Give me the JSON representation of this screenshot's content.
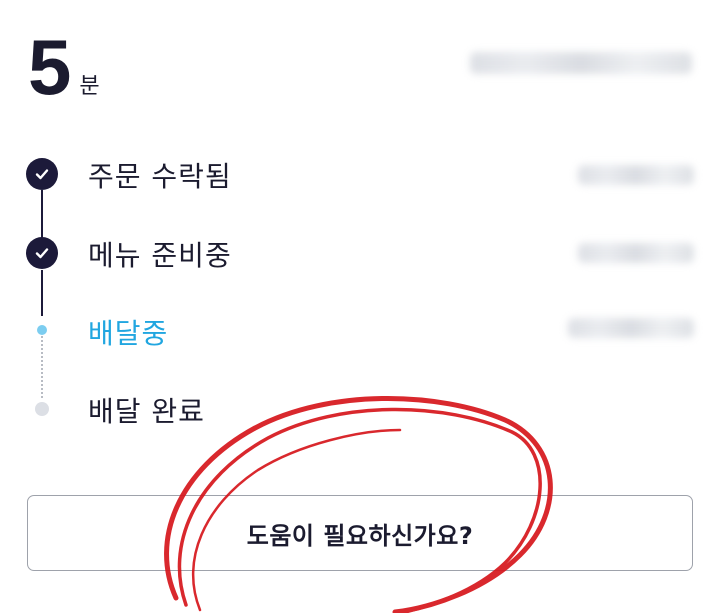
{
  "eta": {
    "value": "5",
    "unit": "분"
  },
  "steps": [
    {
      "label": "주문 수락됨",
      "status": "done"
    },
    {
      "label": "메뉴 준비중",
      "status": "done"
    },
    {
      "label": "배달중",
      "status": "current"
    },
    {
      "label": "배달 완료",
      "status": "pending"
    }
  ],
  "help": {
    "label": "도움이 필요하신가요?"
  },
  "colors": {
    "primary": "#1c1a3a",
    "active": "#21a6e0",
    "pending": "#dcdfe5",
    "annotation": "#d6161c"
  },
  "icons": {
    "done_marker": "check-icon"
  }
}
